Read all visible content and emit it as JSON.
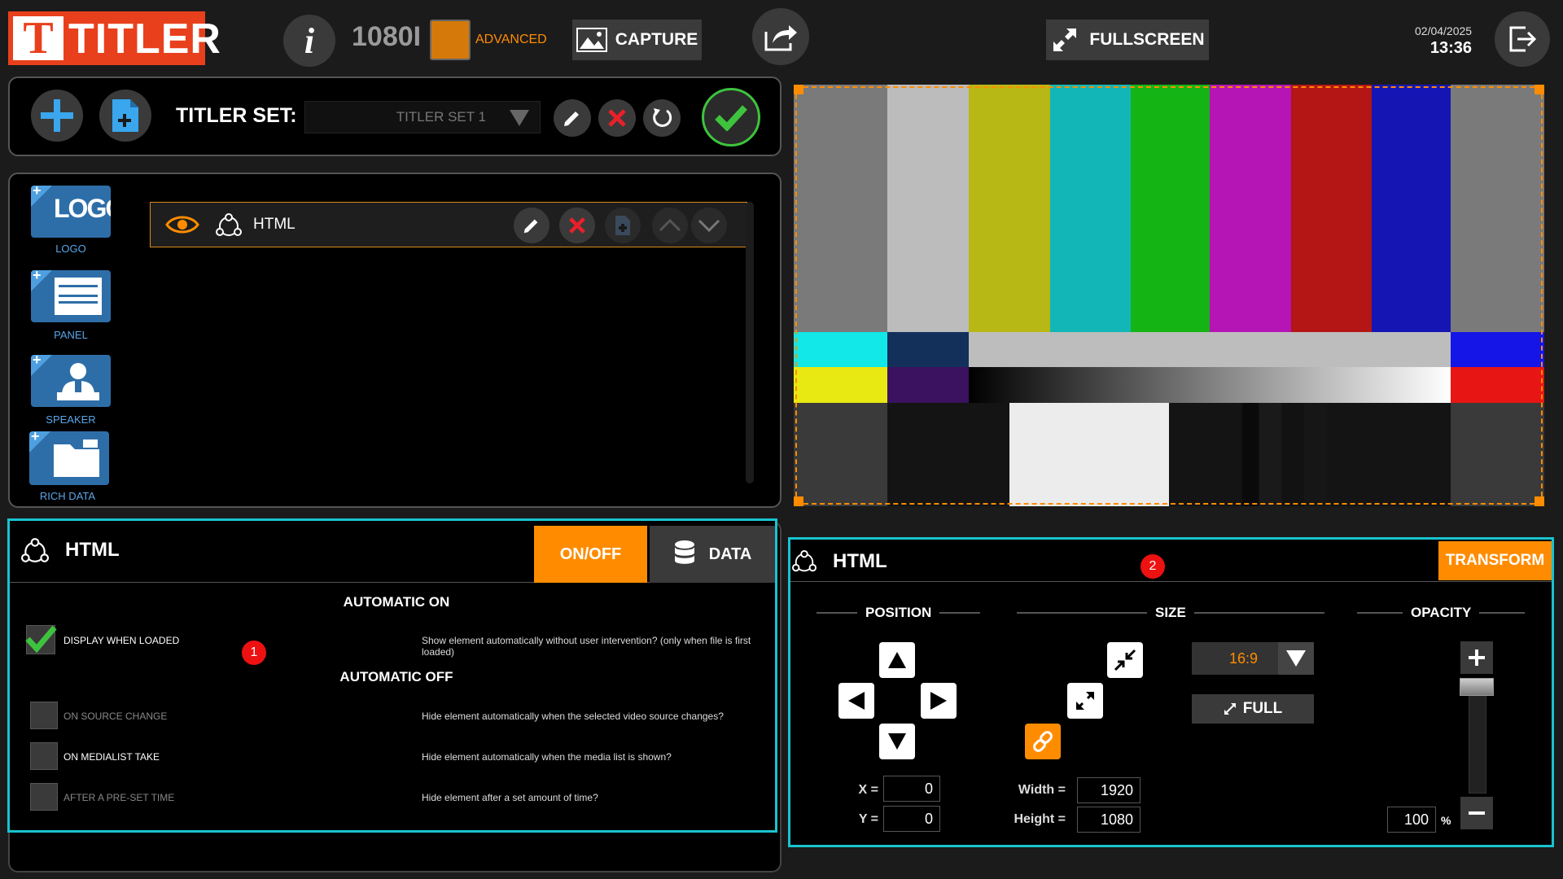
{
  "app": {
    "logo_letter": "T",
    "logo_text": "TITLER",
    "resolution": "1080I",
    "mode_label": "ADVANCED"
  },
  "header": {
    "capture_label": "CAPTURE",
    "fullscreen_label": "FULLSCREEN",
    "date": "02/04/2025",
    "time": "13:36"
  },
  "titler_set": {
    "label": "TITLER SET:",
    "selected": "TITLER SET 1"
  },
  "library": {
    "items": [
      {
        "label": "LOGO",
        "icon_text": "LOGO"
      },
      {
        "label": "PANEL"
      },
      {
        "label": "SPEAKER"
      },
      {
        "label": "RICH DATA"
      }
    ]
  },
  "layers": [
    {
      "name": "HTML",
      "visible": true
    }
  ],
  "left_panel": {
    "title": "HTML",
    "tab_onoff": "ON/OFF",
    "tab_data": "DATA",
    "automatic_on": "AUTOMATIC ON",
    "automatic_off": "AUTOMATIC OFF",
    "badge": "1",
    "options": [
      {
        "label": "DISPLAY WHEN LOADED",
        "desc": "Show element automatically without user intervention? (only when file is first loaded)",
        "checked": true
      },
      {
        "label": "ON SOURCE CHANGE",
        "desc": "Hide element automatically when the selected video source changes?",
        "checked": false
      },
      {
        "label": "ON MEDIALIST TAKE",
        "desc": "Hide element automatically when the media list is shown?",
        "checked": false
      },
      {
        "label": "AFTER A PRE-SET TIME",
        "desc": "Hide element after a set amount of time?",
        "checked": false
      }
    ]
  },
  "right_panel": {
    "title": "HTML",
    "tab_transform": "TRANSFORM",
    "badge": "2",
    "position_label": "POSITION",
    "size_label": "SIZE",
    "opacity_label": "OPACITY",
    "x_label": "X =",
    "y_label": "Y =",
    "x": "0",
    "y": "0",
    "width_label": "Width =",
    "height_label": "Height =",
    "width": "1920",
    "height": "1080",
    "aspect": "16:9",
    "full_label": "FULL",
    "opacity": "100",
    "opacity_unit": "%"
  },
  "colors": {
    "accent_orange": "#ff8c00",
    "teal_outline": "#19c3cf",
    "logo_red": "#e8401c"
  },
  "preview": {
    "top_bars": [
      "#7a7a7a",
      "#bcbcbc",
      "#b7b715",
      "#13b6b6",
      "#15b415",
      "#b415b4",
      "#b41515",
      "#1515b4",
      "#7a7a7a"
    ]
  }
}
